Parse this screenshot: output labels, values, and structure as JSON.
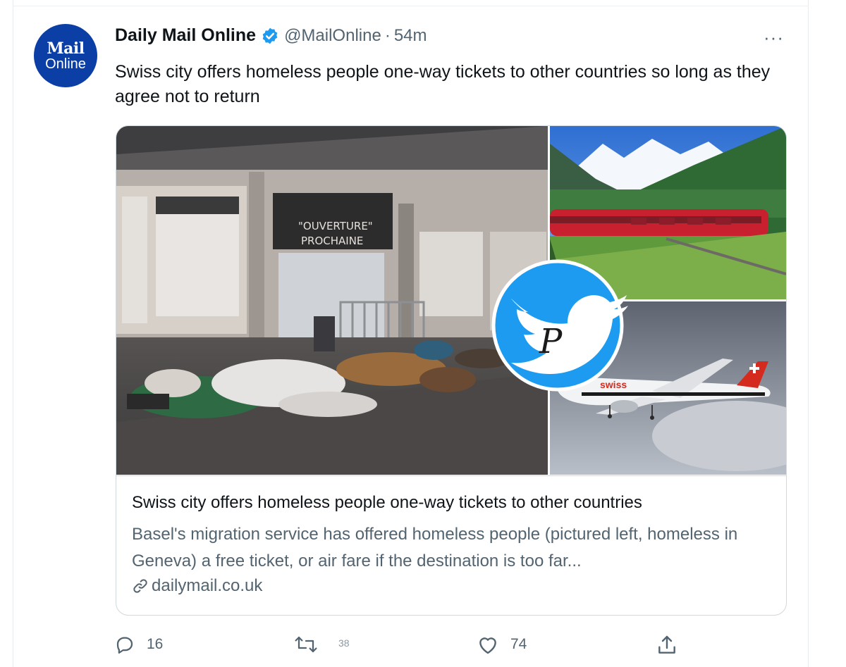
{
  "author": {
    "avatar_line1": "Mail",
    "avatar_line2": "Online",
    "display_name": "Daily Mail Online",
    "handle": "@MailOnline",
    "separator": "·",
    "timestamp": "54m",
    "verified": true
  },
  "more_label": "···",
  "tweet": {
    "text": "Swiss city offers homeless people one-way tickets to other countries so long as they agree not to return"
  },
  "card": {
    "sign_line1": "\"OUVERTURE\"",
    "sign_line2": "PROCHAINE",
    "plane_livery": "swiss",
    "title": "Swiss city offers homeless people one-way tickets to other countries",
    "description": "Basel's migration service has offered homeless people (pictured left, homeless in Geneva) a free ticket, or air fare if the destination is too far...",
    "domain": "dailymail.co.uk"
  },
  "watermark": {
    "letter": "P",
    "icon": "twitter-bird-icon"
  },
  "actions": {
    "reply_count": "16",
    "retweet_count": "38",
    "like_count": "74"
  },
  "icons": [
    "verified-badge-icon",
    "more-icon",
    "link-icon",
    "reply-icon",
    "retweet-icon",
    "like-icon",
    "share-icon"
  ],
  "colors": {
    "accent": "#1d9bf0",
    "avatar_bg": "#0b3fa6",
    "text_primary": "#0f1419",
    "text_secondary": "#536471",
    "border": "#cfd9de"
  }
}
